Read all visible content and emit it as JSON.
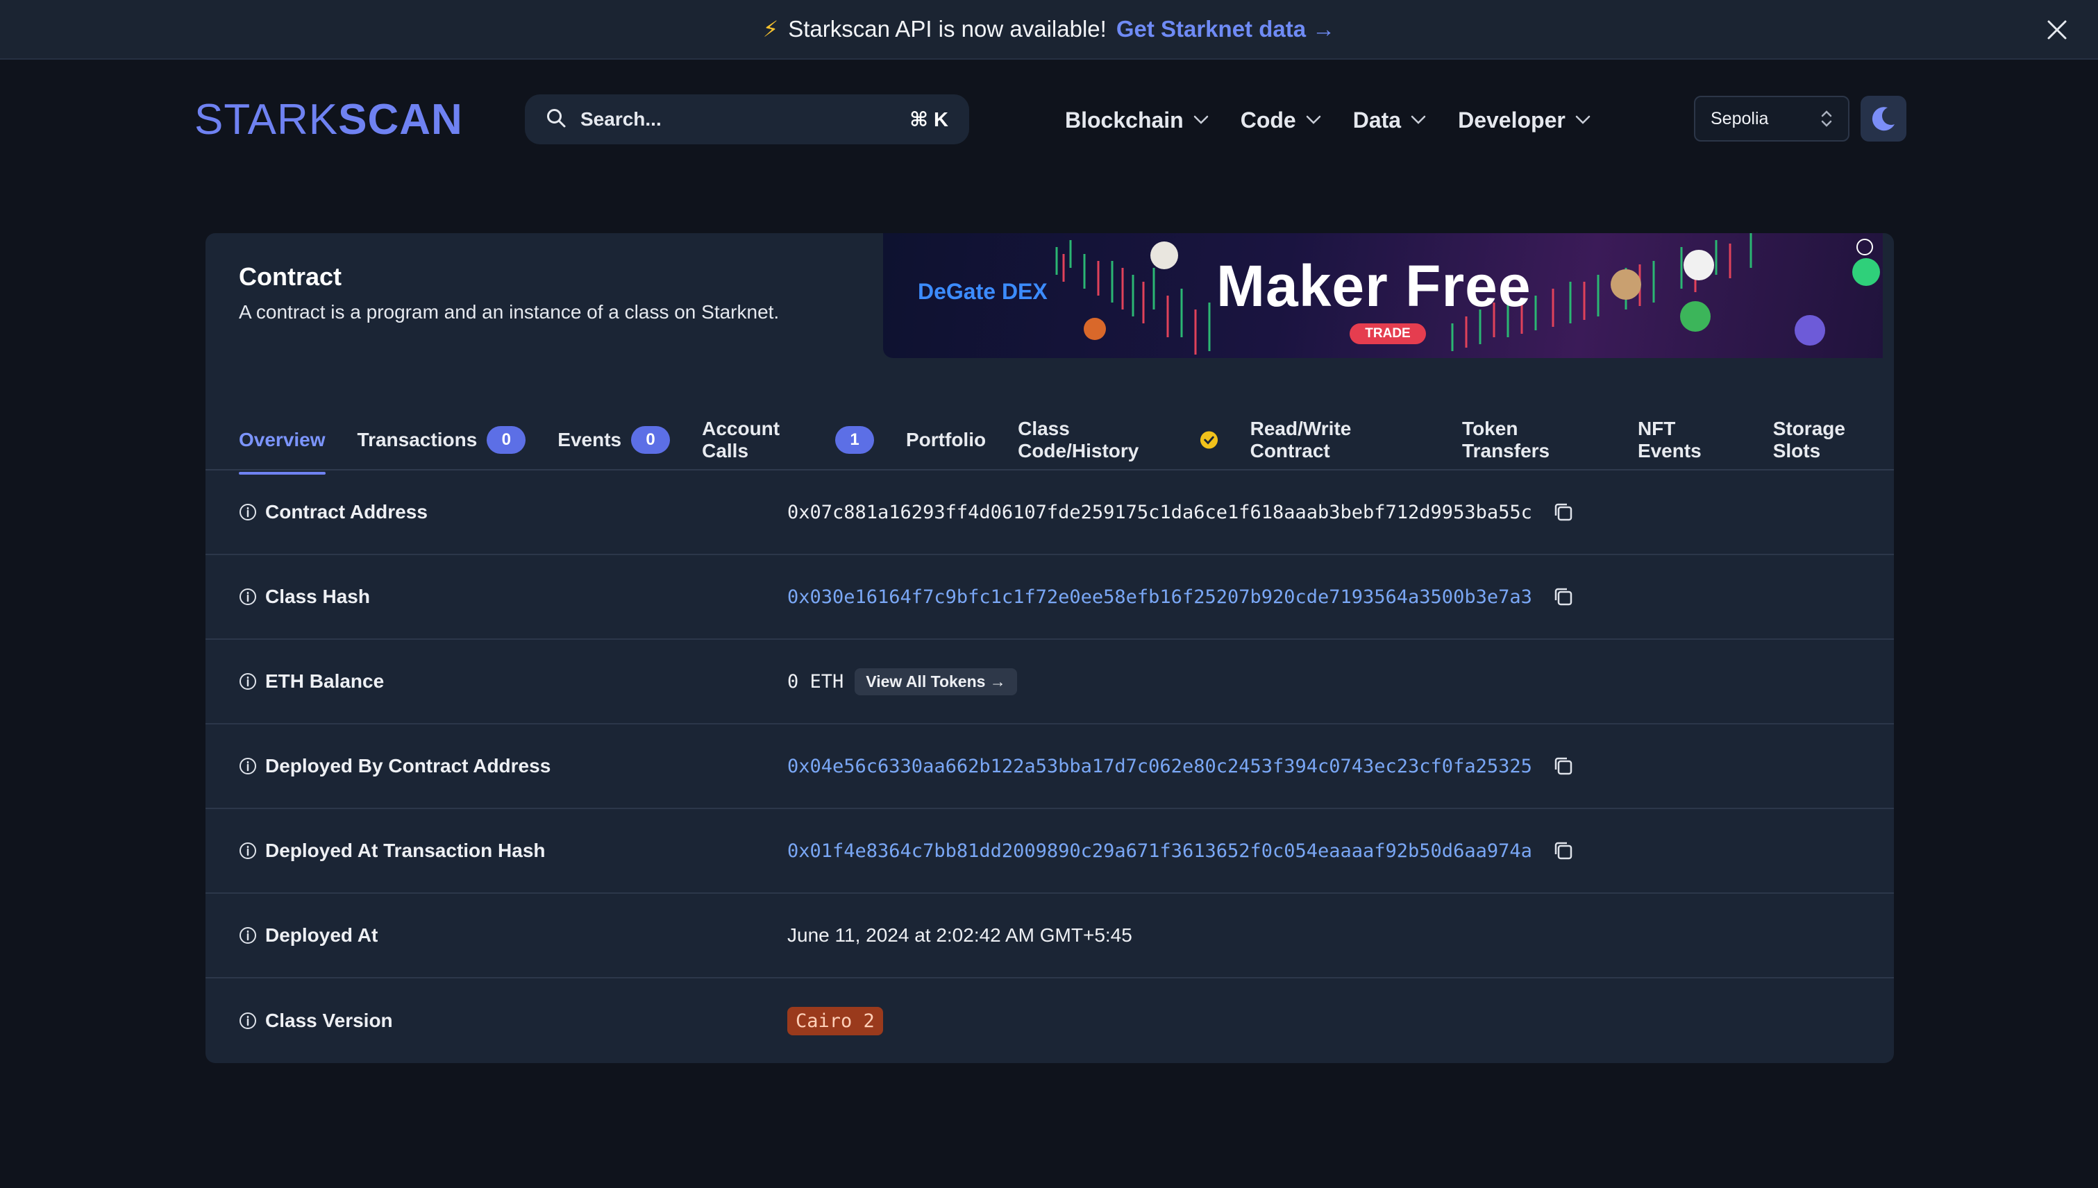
{
  "banner": {
    "icon": "lightning-icon",
    "message": "Starkscan API is now available!",
    "cta": "Get Starknet data →"
  },
  "header": {
    "logo_light": "STARK",
    "logo_bold": "SCAN",
    "search_placeholder": "Search...",
    "search_shortcut": "⌘ K",
    "nav": [
      "Blockchain",
      "Code",
      "Data",
      "Developer"
    ],
    "network": "Sepolia"
  },
  "contract": {
    "title": "Contract",
    "subtitle": "A contract is a program and an instance of a class on Starknet."
  },
  "ad": {
    "brand": "DeGate DEX",
    "headline": "Maker Free",
    "tag": "TRADE"
  },
  "tabs": [
    {
      "label": "Overview"
    },
    {
      "label": "Transactions",
      "badge": "0"
    },
    {
      "label": "Events",
      "badge": "0"
    },
    {
      "label": "Account Calls",
      "badge": "1"
    },
    {
      "label": "Portfolio"
    },
    {
      "label": "Class Code/History"
    },
    {
      "label": "Read/Write Contract"
    },
    {
      "label": "Token Transfers"
    },
    {
      "label": "NFT Events"
    },
    {
      "label": "Storage Slots"
    }
  ],
  "rows": {
    "contract_address": {
      "label": "Contract Address",
      "value": "0x07c881a16293ff4d06107fde259175c1da6ce1f618aaab3bebf712d9953ba55c"
    },
    "class_hash": {
      "label": "Class Hash",
      "value": "0x030e16164f7c9bfc1c1f72e0ee58efb16f25207b920cde7193564a3500b3e7a3"
    },
    "eth_balance": {
      "label": "ETH Balance",
      "value": "0 ETH",
      "button": "View All Tokens →"
    },
    "deployed_by": {
      "label": "Deployed By Contract Address",
      "value": "0x04e56c6330aa662b122a53bba17d7c062e80c2453f394c0743ec23cf0fa25325"
    },
    "deployed_tx": {
      "label": "Deployed At Transaction Hash",
      "value": "0x01f4e8364c7bb81dd2009890c29a671f3613652f0c054eaaaaf92b50d6aa974a"
    },
    "deployed_at": {
      "label": "Deployed At",
      "value": "June 11, 2024 at 2:02:42 AM GMT+5:45"
    },
    "class_version": {
      "label": "Class Version",
      "value": "Cairo 2"
    }
  },
  "colors": {
    "accent": "#6f82f2",
    "link": "#7aa7f5",
    "badge": "#5c6fe6",
    "cairo_badge": "#9a3a1c"
  }
}
